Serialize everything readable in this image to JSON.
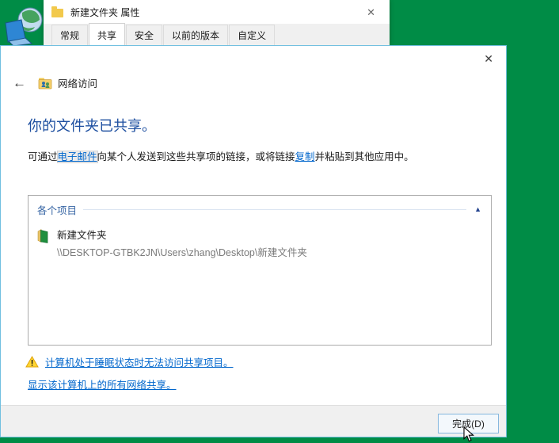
{
  "colors": {
    "desktop_green": "#008C46",
    "dialog_border_blue": "#71C0E0",
    "heading_blue": "#1E4FA0",
    "link_blue": "#0066CC",
    "group_header_blue": "#3665A4",
    "warning_yellow": "#FFD633"
  },
  "icons": {
    "close": "✕",
    "back": "←",
    "collapse_caret": "▲"
  },
  "properties_window": {
    "title": "新建文件夹 属性",
    "tabs": [
      {
        "label": "常规",
        "active": false
      },
      {
        "label": "共享",
        "active": true
      },
      {
        "label": "安全",
        "active": false
      },
      {
        "label": "以前的版本",
        "active": false
      },
      {
        "label": "自定义",
        "active": false
      }
    ]
  },
  "wizard": {
    "title": "网络访问",
    "heading": "你的文件夹已共享。",
    "body": {
      "prefix": "可通过",
      "email_link": "电子邮件",
      "middle": "向某个人发送到这些共享项的链接，或将链接",
      "copy_link": "复制",
      "suffix": "并粘贴到其他应用中。"
    },
    "group": {
      "header": "各个项目",
      "items": [
        {
          "name": "新建文件夹",
          "path": "\\\\DESKTOP-GTBK2JN\\Users\\zhang\\Desktop\\新建文件夹"
        }
      ]
    },
    "warning_link": "计算机处于睡眠状态时无法访问共享项目。",
    "show_all_link": "显示该计算机上的所有网络共享。",
    "finish_button": "完成(D)"
  }
}
